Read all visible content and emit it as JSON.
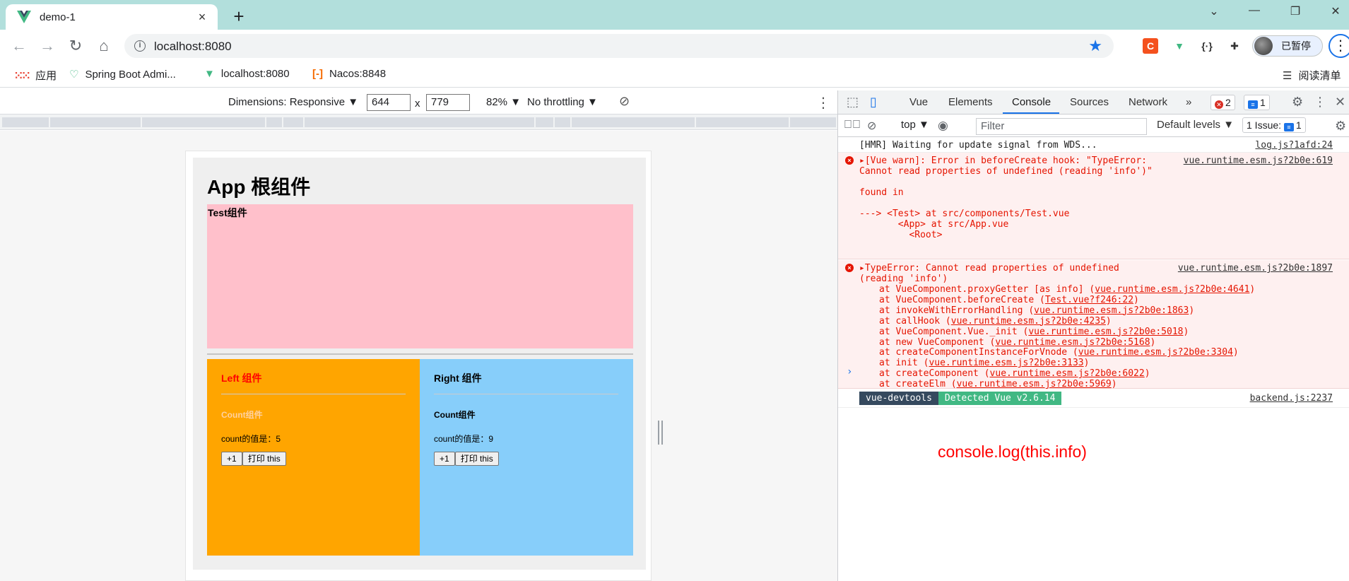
{
  "browser": {
    "tab_title": "demo-1",
    "tab_close_icon": "×",
    "new_tab_icon": "+",
    "url": "localhost:8080",
    "profile_label": "已暂停",
    "window_controls": [
      "⌄",
      "—",
      "❐",
      "✕"
    ]
  },
  "bookmarks": {
    "apps_label": "应用",
    "items": [
      {
        "label": "Spring Boot Admi...",
        "icon": "spring-boot-admin-icon"
      },
      {
        "label": "localhost:8080",
        "icon": "vue-icon"
      },
      {
        "label": "Nacos:8848",
        "icon": "nacos-icon"
      }
    ],
    "reading_list": "阅读清单"
  },
  "device_toolbar": {
    "dimensions_label": "Dimensions: Responsive ▼",
    "width": "644",
    "height": "779",
    "times": "x",
    "zoom": "82% ▼",
    "throttling": "No throttling ▼"
  },
  "app_page": {
    "title": "App 根组件",
    "test_label": "Test组件",
    "left": {
      "title": "Left 组件",
      "count_title": "Count组件",
      "count_value": "count的值是：5",
      "btn_plus": "+1",
      "btn_print": "打印 this"
    },
    "right": {
      "title": "Right 组件",
      "count_title": "Count组件",
      "count_value": "count的值是：9",
      "btn_plus": "+1",
      "btn_print": "打印 this"
    }
  },
  "devtools": {
    "tabs": [
      "Vue",
      "Elements",
      "Console",
      "Sources",
      "Network"
    ],
    "more": "»",
    "error_count": "2",
    "info_count": "1",
    "context": "top ▼",
    "filter_placeholder": "Filter",
    "levels": "Default levels ▼",
    "issues_label": "1 Issue:",
    "issues_count": "1"
  },
  "console": {
    "hmr": {
      "text": "[HMR] Waiting for update signal from WDS...",
      "src": "log.js?1afd:24"
    },
    "warn": {
      "lines": [
        "▸[Vue warn]: Error in beforeCreate hook: \"TypeError:",
        "Cannot read properties of undefined (reading 'info')\"",
        "",
        "found in",
        "",
        "---> <Test> at src/components/Test.vue",
        "       <App> at src/App.vue",
        "         <Root>"
      ],
      "src": "vue.runtime.esm.js?2b0e:619"
    },
    "type_error": {
      "line1": "▸TypeError: Cannot read properties of undefined",
      "line2": "(reading 'info')",
      "src": "vue.runtime.esm.js?2b0e:1897",
      "stack": [
        {
          "at": "at VueComponent.proxyGetter [as info] (",
          "link": "vue.runtime.esm.js?2b0e:4641",
          "end": ")"
        },
        {
          "at": "at VueComponent.beforeCreate (",
          "link": "Test.vue?f246:22",
          "end": ")"
        },
        {
          "at": "at invokeWithErrorHandling (",
          "link": "vue.runtime.esm.js?2b0e:1863",
          "end": ")"
        },
        {
          "at": "at callHook (",
          "link": "vue.runtime.esm.js?2b0e:4235",
          "end": ")"
        },
        {
          "at": "at VueComponent.Vue._init (",
          "link": "vue.runtime.esm.js?2b0e:5018",
          "end": ")"
        },
        {
          "at": "at new VueComponent (",
          "link": "vue.runtime.esm.js?2b0e:5168",
          "end": ")"
        },
        {
          "at": "at createComponentInstanceForVnode (",
          "link": "vue.runtime.esm.js?2b0e:3304",
          "end": ")"
        },
        {
          "at": "at init (",
          "link": "vue.runtime.esm.js?2b0e:3133",
          "end": ")"
        },
        {
          "at": "at createComponent (",
          "link": "vue.runtime.esm.js?2b0e:6022",
          "end": ")"
        },
        {
          "at": "at createElm (",
          "link": "vue.runtime.esm.js?2b0e:5969",
          "end": ")"
        }
      ]
    },
    "devtools_badge": {
      "a": "vue-devtools",
      "b": "Detected Vue v2.6.14",
      "src": "backend.js:2237"
    },
    "prompt": "›",
    "annotation": "console.log(this.info)"
  },
  "colors": {
    "accent": "#1a73e8",
    "error": "#e51400",
    "vue_green": "#41b883"
  }
}
